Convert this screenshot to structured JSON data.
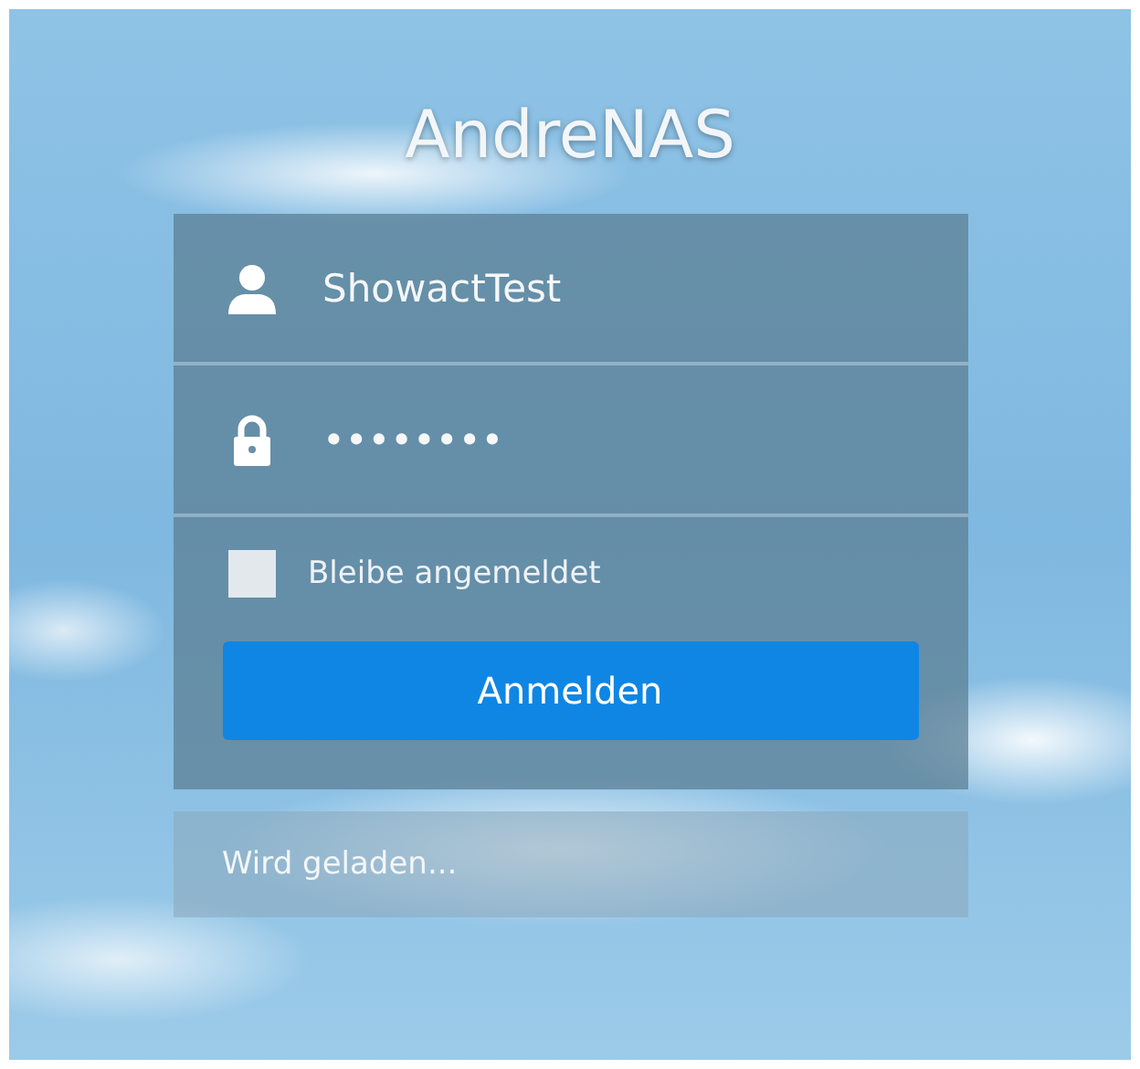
{
  "title": "AndreNAS",
  "username": {
    "value": "ShowactTest"
  },
  "password": {
    "value": "••••••••"
  },
  "remember": {
    "label": "Bleibe angemeldet",
    "checked": false
  },
  "login_button": "Anmelden",
  "status": "Wird geladen..."
}
